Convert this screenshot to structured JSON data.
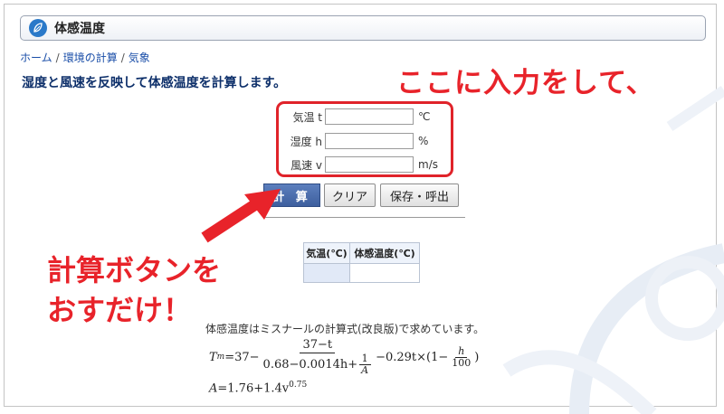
{
  "app": {
    "title": "体感温度",
    "breadcrumb": [
      "ホーム",
      "環境の計算",
      "気象"
    ],
    "headline": "湿度と風速を反映して体感温度を計算します。"
  },
  "annotations": {
    "top": "ここに入力をして、",
    "bottom_line1": "計算ボタンを",
    "bottom_line2": "おすだけ！"
  },
  "form": {
    "rows": [
      {
        "label": "気温 t",
        "value": "",
        "unit": "℃"
      },
      {
        "label": "湿度 h",
        "value": "",
        "unit": "%"
      },
      {
        "label": "風速 v",
        "value": "",
        "unit": "m/s"
      }
    ]
  },
  "buttons": {
    "calc": "計 算",
    "clear": "クリア",
    "save": "保存・呼出"
  },
  "result_table": {
    "headers": [
      "気温(℃)",
      "体感温度(℃)"
    ]
  },
  "formula": {
    "note": "体感温度はミスナールの計算式(改良版)で求めています。",
    "eq1": {
      "lhs_T": "T",
      "lhs_sub": "m",
      "eq_part1": "=37−",
      "frac_num": "37−t",
      "frac_den_part1": "0.68−0.0014h+",
      "inner_num": "1",
      "inner_den": "A",
      "tail_part1": "−0.29t×(1−",
      "frac2_num": "h",
      "frac2_den": "100",
      "tail_part2": ")"
    },
    "eq2": {
      "lhs": "A",
      "rhs": "=1.76+1.4v",
      "exp": "0.75"
    }
  },
  "colors": {
    "accent_red": "#e8232a",
    "title_icon": "#2a79c9",
    "calc_button": "#4a6aab"
  }
}
